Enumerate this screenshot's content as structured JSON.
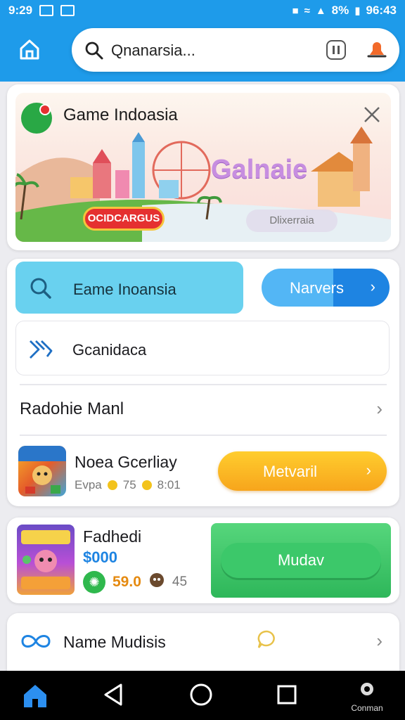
{
  "status_bar": {
    "time": "9:29",
    "battery": "8%",
    "clock_right": "96:43",
    "left_icons": [
      "image-icon",
      "edit-icon"
    ],
    "right_icons": [
      "shield-icon",
      "wifi-icon",
      "signal-icon",
      "battery-icon"
    ]
  },
  "header": {
    "home_icon": "home-icon",
    "search": {
      "text": "Qnanarsia...",
      "icon": "search-icon"
    },
    "actions": [
      "chat-icon",
      "notification-icon"
    ]
  },
  "banner": {
    "title": "Game Indoasia",
    "brand": "Galnaie",
    "pill_red": "OCIDCARGUS",
    "pill_grey": "Dlixerraia",
    "close_icon": "close-icon"
  },
  "card2": {
    "search_tile": {
      "label": "Eame Inoansia"
    },
    "nav_button": {
      "label": "Narvers"
    },
    "category_row": {
      "label": "Gcanidaca"
    },
    "section": {
      "title": "Radohie Manl"
    },
    "game": {
      "name": "Noea Gcerliay",
      "meta_label": "Evpa",
      "meta_value1": "75",
      "meta_value2": "8:01",
      "action_label": "Metvaril"
    }
  },
  "card3": {
    "name": "Fadhedi",
    "price": "$000",
    "value1": "59.0",
    "value2": "45",
    "action_label": "Mudav"
  },
  "card4": {
    "label": "Name Mudisis"
  },
  "navbar": {
    "items": [
      "home-icon",
      "back-icon",
      "circle-home-icon",
      "recents-icon",
      "settings-icon"
    ],
    "settings_label": "Conman"
  },
  "colors": {
    "header_blue": "#1e9bea",
    "accent_green": "#2eb75a",
    "accent_orange": "#f7a51c",
    "tile_cyan": "#69d1ef"
  }
}
